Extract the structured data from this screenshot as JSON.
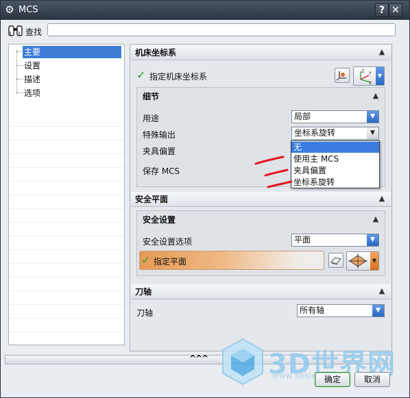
{
  "window": {
    "title": "MCS",
    "help_label": "?",
    "close_label": "✕"
  },
  "search": {
    "label": "查找",
    "value": ""
  },
  "nav": {
    "items": [
      "主要",
      "设置",
      "描述",
      "选项"
    ],
    "selected": "主要"
  },
  "machine_cs": {
    "header": "机床坐标系",
    "specify_label": "指定机床坐标系",
    "details": {
      "header": "细节",
      "purpose_label": "用途",
      "purpose_value": "局部",
      "special_output_label": "特殊输出",
      "special_output_value": "坐标系旋转",
      "fixture_offset_label": "夹具偏置",
      "save_mcs_label": "保存 MCS"
    }
  },
  "dropdown_options": [
    "无",
    "使用主 MCS",
    "夹具偏置",
    "坐标系旋转"
  ],
  "dropdown_selected": "无",
  "safe_plane": {
    "header": "安全平面",
    "settings_header": "安全设置",
    "option_label": "安全设置选项",
    "option_value": "平面",
    "specify_plane_label": "指定平面"
  },
  "tool_axis": {
    "header": "刀轴",
    "label": "刀轴",
    "value": "所有轴"
  },
  "footer": {
    "expand_glyph": "^^^",
    "ok_label": "确定",
    "cancel_label": "取消"
  },
  "watermark": {
    "text": "3D世界网",
    "sub": "WWW.3DSJW.COM"
  },
  "colors": {
    "selection": "#3e7dd6",
    "check": "#2ca02c",
    "annotation": "#e8141e",
    "highlight_row": "#e59a55"
  }
}
